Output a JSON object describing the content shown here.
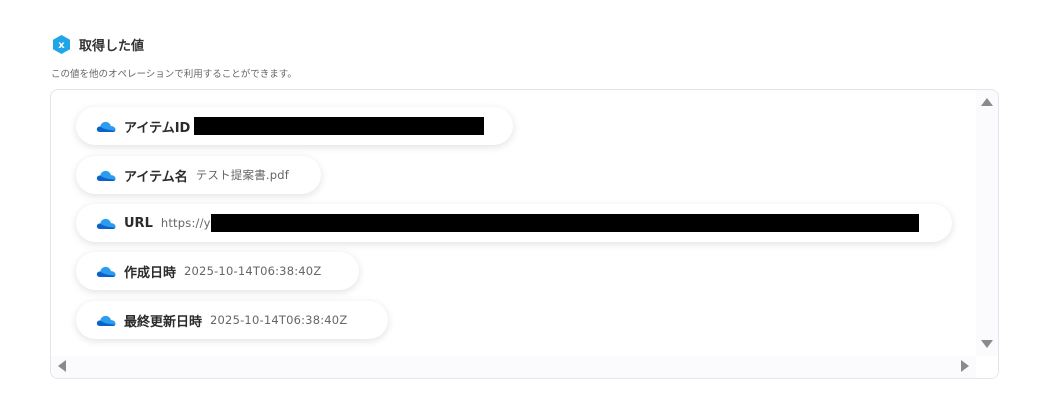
{
  "section": {
    "title": "取得した値",
    "description": "この値を他のオペレーションで利用することができます。"
  },
  "colors": {
    "badge": "#1ea6e8",
    "cloud_dark": "#0a64c8",
    "cloud_light": "#2b9cf0",
    "redaction": "#000000"
  },
  "items": [
    {
      "label": "アイテムID",
      "value": "",
      "icon": "onedrive-cloud-icon",
      "redacted": true
    },
    {
      "label": "アイテム名",
      "value": "テスト提案書.pdf",
      "icon": "onedrive-cloud-icon",
      "redacted": false
    },
    {
      "label": "URL",
      "value": "https://y",
      "icon": "onedrive-cloud-icon",
      "redacted": true
    },
    {
      "label": "作成日時",
      "value": "2025-10-14T06:38:40Z",
      "icon": "onedrive-cloud-icon",
      "redacted": false
    },
    {
      "label": "最終更新日時",
      "value": "2025-10-14T06:38:40Z",
      "icon": "onedrive-cloud-icon",
      "redacted": false
    }
  ],
  "scrollbars": {
    "up_icon": "triangle-up-icon",
    "down_icon": "triangle-down-icon",
    "left_icon": "triangle-left-icon",
    "right_icon": "triangle-right-icon"
  }
}
